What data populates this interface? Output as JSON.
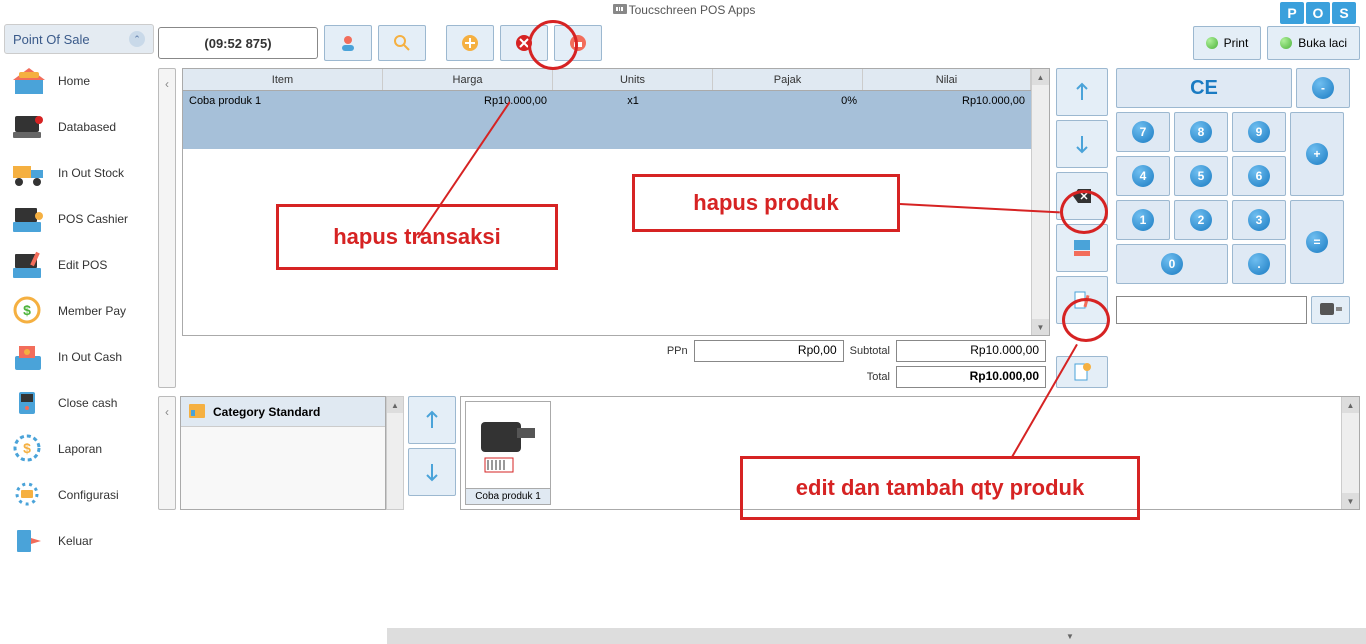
{
  "title": "Toucschreen POS Apps",
  "pos_badge": [
    "P",
    "O",
    "S"
  ],
  "sidebar": {
    "title": "Point Of Sale",
    "items": [
      {
        "label": "Home",
        "icon": "home-icon"
      },
      {
        "label": "Databased",
        "icon": "database-icon"
      },
      {
        "label": "In Out Stock",
        "icon": "truck-icon"
      },
      {
        "label": "POS Cashier",
        "icon": "cashier-icon"
      },
      {
        "label": "Edit POS",
        "icon": "edit-pos-icon"
      },
      {
        "label": "Member Pay",
        "icon": "member-pay-icon"
      },
      {
        "label": "In Out Cash",
        "icon": "cash-icon"
      },
      {
        "label": "Close cash",
        "icon": "close-cash-icon"
      },
      {
        "label": "Laporan",
        "icon": "report-icon"
      },
      {
        "label": "Configurasi",
        "icon": "config-icon"
      },
      {
        "label": "Keluar",
        "icon": "exit-icon"
      }
    ]
  },
  "toolbar": {
    "time": "(09:52 875)",
    "print_label": "Print",
    "drawer_label": "Buka laci"
  },
  "table": {
    "headers": {
      "item": "Item",
      "harga": "Harga",
      "units": "Units",
      "pajak": "Pajak",
      "nilai": "Nilai"
    },
    "rows": [
      {
        "item": "Coba produk 1",
        "harga": "Rp10.000,00",
        "units": "x1",
        "pajak": "0%",
        "nilai": "Rp10.000,00"
      }
    ]
  },
  "totals": {
    "ppn_label": "PPn",
    "ppn_val": "Rp0,00",
    "subtotal_label": "Subtotal",
    "subtotal_val": "Rp10.000,00",
    "total_label": "Total",
    "total_val": "Rp10.000,00"
  },
  "keypad": {
    "CE": "CE",
    "minus": "-",
    "plus": "+",
    "eq": "=",
    "dot": ".",
    "n0": "0",
    "n1": "1",
    "n2": "2",
    "n3": "3",
    "n4": "4",
    "n5": "5",
    "n6": "6",
    "n7": "7",
    "n8": "8",
    "n9": "9"
  },
  "category": {
    "title": "Category Standard"
  },
  "products": [
    {
      "label": "Coba produk 1"
    }
  ],
  "annotations": {
    "hapus_transaksi": "hapus transaksi",
    "hapus_produk": "hapus produk",
    "edit_qty": "edit dan tambah qty produk"
  }
}
